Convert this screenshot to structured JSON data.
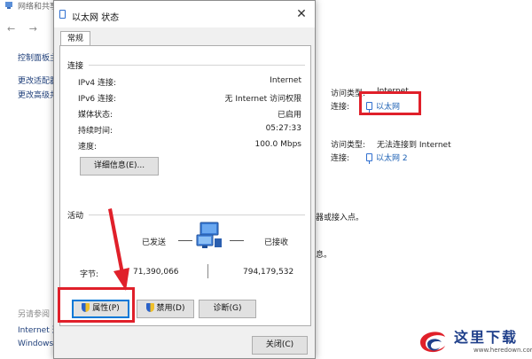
{
  "background": {
    "title": "网络和共享中心",
    "nav_arrows": "←  →",
    "left_links": [
      "控制面板主",
      "更改适配器",
      "更改高级共"
    ],
    "see_also_label": "另请参阅",
    "see_also_items": [
      "Internet 选",
      "Windows"
    ],
    "network1": {
      "access_type_label": "访问类型:",
      "access_type_value": "Internet",
      "connection_label": "连接:",
      "connection_value": "以太网"
    },
    "network2": {
      "access_type_label": "访问类型:",
      "access_type_value": "无法连接到 Internet",
      "connection_label": "连接:",
      "connection_value": "以太网 2"
    },
    "fragment1": "器或接入点。",
    "fragment2": "息。"
  },
  "dialog": {
    "title": "以太网 状态",
    "close_glyph": "✕",
    "tab_general": "常规",
    "connection_group": "连接",
    "rows": [
      {
        "label": "IPv4 连接:",
        "value": "Internet"
      },
      {
        "label": "IPv6 连接:",
        "value": "无 Internet 访问权限"
      },
      {
        "label": "媒体状态:",
        "value": "已启用"
      },
      {
        "label": "持续时间:",
        "value": "05:27:33"
      },
      {
        "label": "速度:",
        "value": "100.0 Mbps"
      }
    ],
    "details_button": "详细信息(E)...",
    "activity_group": "活动",
    "sent_label": "已发送",
    "received_label": "已接收",
    "bytes_label": "字节:",
    "bytes_sent": "71,390,066",
    "bytes_received": "794,179,532",
    "properties_button": "属性(P)",
    "disable_button": "禁用(D)",
    "diagnose_button": "诊断(G)",
    "close_button": "关闭(C)"
  },
  "watermark": {
    "text": "这里下载",
    "sub": "www.heredown.com"
  },
  "colors": {
    "highlight_red": "#e0202a",
    "link_blue": "#1a5fb4"
  }
}
